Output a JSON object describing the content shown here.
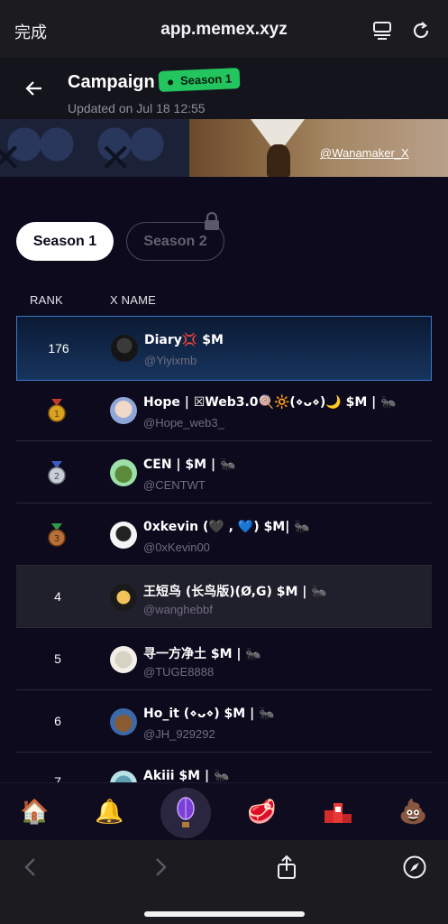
{
  "browser": {
    "done_label": "完成",
    "url": "app.memex.xyz"
  },
  "header": {
    "title": "Campaign",
    "badge": "Season 1",
    "updated": "Updated on Jul 18 12:55"
  },
  "banner": {
    "credit": "@Wanamaker_X"
  },
  "tabs": [
    {
      "label": "Season 1",
      "active": true
    },
    {
      "label": "Season 2",
      "active": false,
      "locked": true
    }
  ],
  "table": {
    "col_rank": "RANK",
    "col_name": "X NAME",
    "rows": [
      {
        "rank": "176",
        "name": "Diary💢 $M",
        "handle": "@Yiyixmb",
        "style": "highlight"
      },
      {
        "rank": "",
        "medal": "gold",
        "name": "Hope | ☒Web3.0🍭🔆(⋄ᴗ⋄)🌙 $M | 🐜",
        "handle": "@Hope_web3_"
      },
      {
        "rank": "",
        "medal": "silver",
        "name": "CEN | $M | 🐜",
        "handle": "@CENTWT"
      },
      {
        "rank": "",
        "medal": "bronze",
        "name": "0xkevin (🖤 , 💙) $M| 🐜",
        "handle": "@0xKevin00"
      },
      {
        "rank": "4",
        "name": "王短鸟 (长鸟版)(Ø,G) $M | 🐜",
        "handle": "@wanghebbf",
        "style": "alt"
      },
      {
        "rank": "5",
        "name": "寻一方净土 $M | 🐜",
        "handle": "@TUGE8888"
      },
      {
        "rank": "6",
        "name": "Ho_it (⋄ᴗ⋄) $M | 🐜",
        "handle": "@JH_929292"
      },
      {
        "rank": "7",
        "name": "Akiii $M | 🐜",
        "handle": ""
      }
    ]
  },
  "nav": [
    {
      "icon": "home-icon",
      "glyph": "🏠"
    },
    {
      "icon": "bell-icon",
      "glyph": "🔔"
    },
    {
      "icon": "balloon-icon",
      "glyph": ""
    },
    {
      "icon": "meat-icon",
      "glyph": "🥩"
    },
    {
      "icon": "podium-icon",
      "glyph": ""
    },
    {
      "icon": "poop-icon",
      "glyph": "💩"
    }
  ]
}
